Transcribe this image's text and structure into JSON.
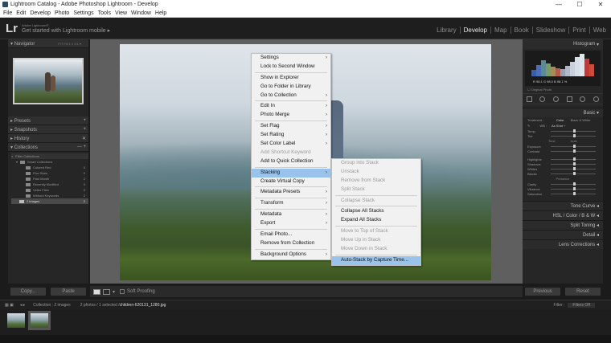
{
  "window": {
    "title": "Lightroom Catalog - Adobe Photoshop Lightroom - Develop"
  },
  "menubar": [
    "File",
    "Edit",
    "Develop",
    "Photo",
    "Settings",
    "Tools",
    "View",
    "Window",
    "Help"
  ],
  "identity": {
    "logo": "Lr",
    "small": "Adobe Lightroom®",
    "text": "Get started with Lightroom mobile ▸"
  },
  "modules": [
    "Library",
    "Develop",
    "Map",
    "Book",
    "Slideshow",
    "Print",
    "Web"
  ],
  "left_panel": {
    "navigator": "Navigator",
    "navigator_opts": "FIT  Fill  1:1  3:1 ▾",
    "presets": "Presets",
    "snapshots": "Snapshots",
    "history": "History",
    "collections": "Collections",
    "filter_collections": "Filter Collections",
    "smart_collections": "Smart Collections",
    "items": [
      {
        "name": "Colored Red",
        "count": "0"
      },
      {
        "name": "Five Stars",
        "count": "0"
      },
      {
        "name": "Past Month",
        "count": "2"
      },
      {
        "name": "Recently Modified",
        "count": "0"
      },
      {
        "name": "Video Files",
        "count": "0"
      },
      {
        "name": "Without Keywords",
        "count": "2"
      }
    ],
    "selected_collection": {
      "name": "2 images",
      "count": "2"
    },
    "copy_btn": "Copy...",
    "paste_btn": "Paste"
  },
  "toolbar": {
    "soft_proofing": "Soft Proofing"
  },
  "right_panel": {
    "histogram": "Histogram",
    "hist_vals": "R  98.1  G  98.0  B  98.1 %",
    "original_photo": "Original Photo",
    "basic": "Basic",
    "treatment_label": "Treatment :",
    "treatment_color": "Color",
    "treatment_bw": "Black & White",
    "wb_label": "WB :",
    "wb_value": "As Shot ÷",
    "temp": "Temp",
    "tint": "Tint",
    "tone": "Tone",
    "auto": "Auto",
    "exposure": "Exposure",
    "contrast": "Contrast",
    "highlights": "Highlights",
    "shadows": "Shadows",
    "whites": "Whites",
    "blacks": "Blacks",
    "presence": "Presence",
    "clarity": "Clarity",
    "vibrance": "Vibrance",
    "saturation": "Saturation",
    "tone_curve": "Tone Curve",
    "hsl": "HSL  /  Color  /  B & W",
    "split_toning": "Split Toning",
    "detail": "Detail",
    "lens_corrections": "Lens Corrections",
    "previous_btn": "Previous",
    "reset_btn": "Reset"
  },
  "filmbar": {
    "collection": "Collection : 2 images",
    "selected": "2 photos / 1 selected / ",
    "filename": "children-620131_1280.jpg",
    "filter_label": "Filter :",
    "filter_value": "Filters Off"
  },
  "context_menu": {
    "items": [
      {
        "label": "Settings",
        "sub": true
      },
      {
        "label": "Lock to Second Window"
      },
      {
        "sep": true
      },
      {
        "label": "Show in Explorer"
      },
      {
        "label": "Go to Folder in Library"
      },
      {
        "label": "Go to Collection",
        "sub": true
      },
      {
        "sep": true
      },
      {
        "label": "Edit In",
        "sub": true
      },
      {
        "label": "Photo Merge",
        "sub": true
      },
      {
        "sep": true
      },
      {
        "label": "Set Flag",
        "sub": true
      },
      {
        "label": "Set Rating",
        "sub": true
      },
      {
        "label": "Set Color Label",
        "sub": true
      },
      {
        "label": "Add Shortcut Keyword",
        "disabled": true
      },
      {
        "label": "Add to Quick Collection"
      },
      {
        "sep": true
      },
      {
        "label": "Stacking",
        "sub": true,
        "highlight": true
      },
      {
        "label": "Create Virtual Copy"
      },
      {
        "sep": true
      },
      {
        "label": "Metadata Presets",
        "sub": true
      },
      {
        "sep": true
      },
      {
        "label": "Transform",
        "sub": true
      },
      {
        "sep": true
      },
      {
        "label": "Metadata",
        "sub": true
      },
      {
        "label": "Export",
        "sub": true
      },
      {
        "sep": true
      },
      {
        "label": "Email Photo..."
      },
      {
        "label": "Remove from Collection"
      },
      {
        "sep": true
      },
      {
        "label": "Background Options",
        "sub": true
      }
    ]
  },
  "stacking_submenu": {
    "items": [
      {
        "label": "Group into Stack",
        "disabled": true
      },
      {
        "label": "Unstack",
        "disabled": true
      },
      {
        "label": "Remove from Stack",
        "disabled": true
      },
      {
        "label": "Split Stack",
        "disabled": true
      },
      {
        "sep": true
      },
      {
        "label": "Collapse Stack",
        "disabled": true
      },
      {
        "sep": true
      },
      {
        "label": "Collapse All Stacks"
      },
      {
        "label": "Expand All Stacks"
      },
      {
        "sep": true
      },
      {
        "label": "Move to Top of Stack",
        "disabled": true
      },
      {
        "label": "Move Up in Stack",
        "disabled": true
      },
      {
        "label": "Move Down in Stack",
        "disabled": true
      },
      {
        "sep": true
      },
      {
        "label": "Auto-Stack by Capture Time...",
        "highlight": true
      }
    ]
  }
}
